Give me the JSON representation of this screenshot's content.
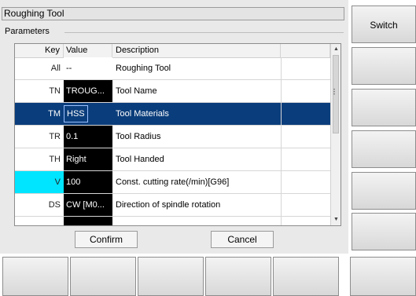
{
  "window": {
    "title": "Roughing Tool",
    "group_label": "Parameters"
  },
  "table": {
    "headers": {
      "key": "Key",
      "value": "Value",
      "description": "Description"
    },
    "rows": [
      {
        "key": "All",
        "value": "--",
        "description": "Roughing Tool"
      },
      {
        "key": "TN",
        "value": "TROUG...",
        "description": "Tool Name"
      },
      {
        "key": "TM",
        "value": "HSS",
        "description": "Tool Materials"
      },
      {
        "key": "TR",
        "value": "0.1",
        "description": "Tool Radius"
      },
      {
        "key": "TH",
        "value": "Right",
        "description": "Tool Handed"
      },
      {
        "key": "V",
        "value": "100",
        "description": "Const. cutting rate(/min)[G96]"
      },
      {
        "key": "DS",
        "value": "CW [M0...",
        "description": "Direction of spindle rotation"
      },
      {
        "key": "",
        "value": "",
        "description": ""
      }
    ],
    "selected_row_index": 2
  },
  "buttons": {
    "confirm": "Confirm",
    "cancel": "Cancel"
  },
  "softkeys": {
    "right": [
      "Switch",
      "",
      "",
      "",
      "",
      ""
    ],
    "bottom": [
      "",
      "",
      "",
      "",
      "",
      ""
    ]
  },
  "colors": {
    "selection": "#0a3d7b",
    "highlight_key": "#00e5ff"
  },
  "icons": {
    "scroll_up": "triangle-up",
    "scroll_down": "triangle-down"
  }
}
